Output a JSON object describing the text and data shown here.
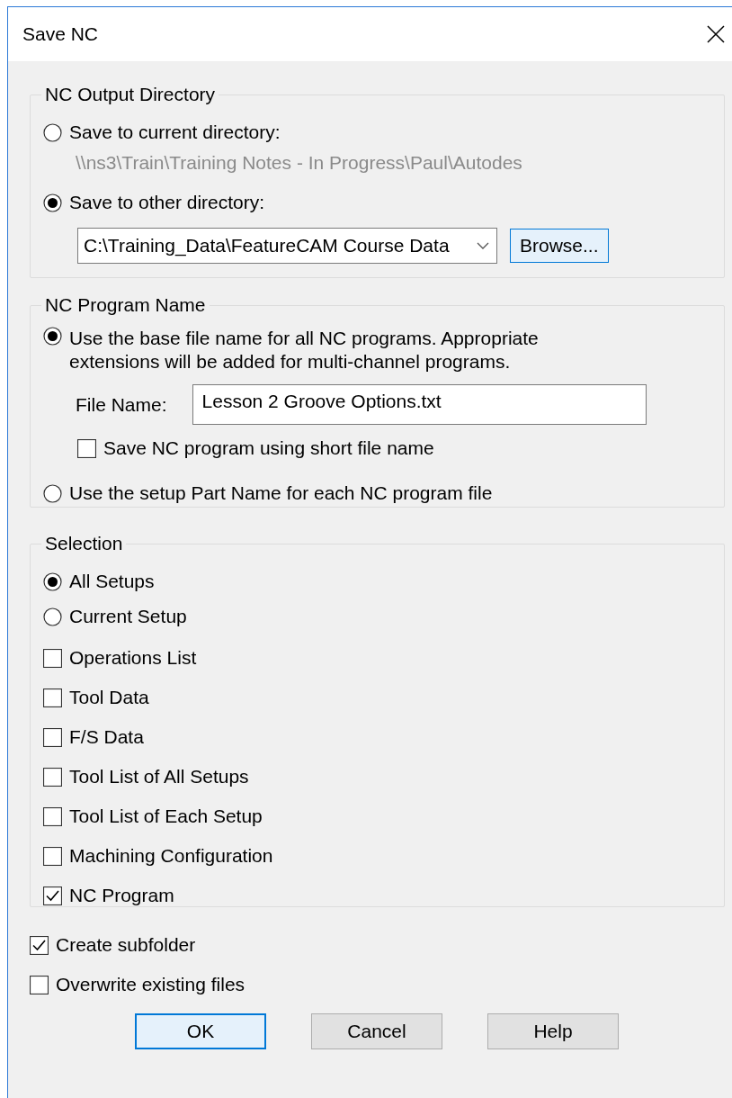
{
  "window": {
    "title": "Save NC"
  },
  "output_directory": {
    "legend": "NC Output Directory",
    "options": [
      {
        "label": "Save to current directory:",
        "selected": false,
        "path": "\\\\ns3\\Train\\Training Notes - In Progress\\Paul\\Autodes"
      },
      {
        "label": "Save to other directory:",
        "selected": true
      }
    ],
    "directory": {
      "value": "C:\\Training_Data\\FeatureCAM Course Data"
    },
    "browse_button": "Browse..."
  },
  "program_name": {
    "legend": "NC Program Name",
    "base_option": {
      "label": "Use the base file name for all NC programs. Appropriate extensions will be added for multi-channel programs.",
      "selected": true
    },
    "file_name": {
      "label": "File Name:",
      "value": "Lesson 2 Groove Options.txt"
    },
    "short_name": {
      "label": "Save NC program using short file name",
      "checked": false
    },
    "part_option": {
      "label": "Use the setup Part Name for each NC program file",
      "selected": false
    }
  },
  "selection": {
    "legend": "Selection",
    "scopes": [
      {
        "label": "All Setups",
        "selected": true
      },
      {
        "label": "Current Setup",
        "selected": false
      }
    ],
    "items": [
      {
        "label": "Operations List",
        "checked": false
      },
      {
        "label": "Tool Data",
        "checked": false
      },
      {
        "label": "F/S Data",
        "checked": false
      },
      {
        "label": "Tool List of All Setups",
        "checked": false
      },
      {
        "label": "Tool List of Each Setup",
        "checked": false
      },
      {
        "label": "Machining Configuration",
        "checked": false
      },
      {
        "label": "NC Program",
        "checked": true
      }
    ]
  },
  "options": [
    {
      "label": "Create subfolder",
      "checked": true
    },
    {
      "label": "Overwrite existing files",
      "checked": false
    }
  ],
  "buttons": [
    {
      "label": "OK",
      "focused": true
    },
    {
      "label": "Cancel",
      "focused": false
    },
    {
      "label": "Help",
      "focused": false
    }
  ]
}
